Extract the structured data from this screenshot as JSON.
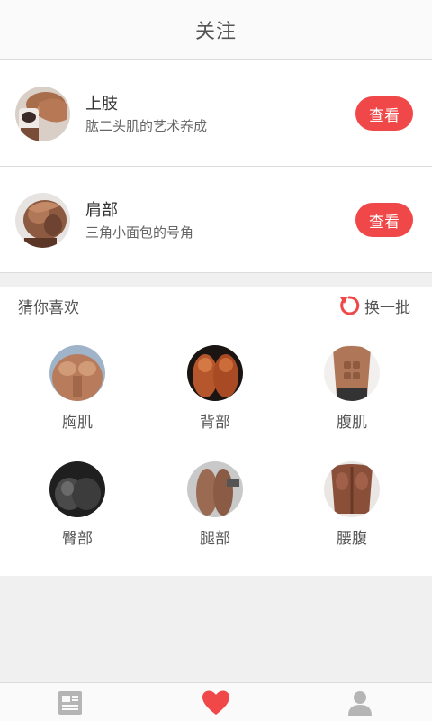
{
  "header": {
    "title": "关注"
  },
  "follows": [
    {
      "title": "上肢",
      "subtitle": "肱二头肌的艺术养成",
      "button": "查看"
    },
    {
      "title": "肩部",
      "subtitle": "三角小面包的号角",
      "button": "查看"
    }
  ],
  "guess": {
    "title": "猜你喜欢",
    "refresh_label": "换一批",
    "items": [
      {
        "label": "胸肌"
      },
      {
        "label": "背部"
      },
      {
        "label": "腹肌"
      },
      {
        "label": "臀部"
      },
      {
        "label": "腿部"
      },
      {
        "label": "腰腹"
      }
    ]
  },
  "nav": {
    "items": [
      {
        "icon": "news-icon",
        "active": false
      },
      {
        "icon": "heart-icon",
        "active": true
      },
      {
        "icon": "profile-icon",
        "active": false
      }
    ]
  },
  "colors": {
    "accent": "#f04848",
    "inactive": "#b5b5b5"
  }
}
